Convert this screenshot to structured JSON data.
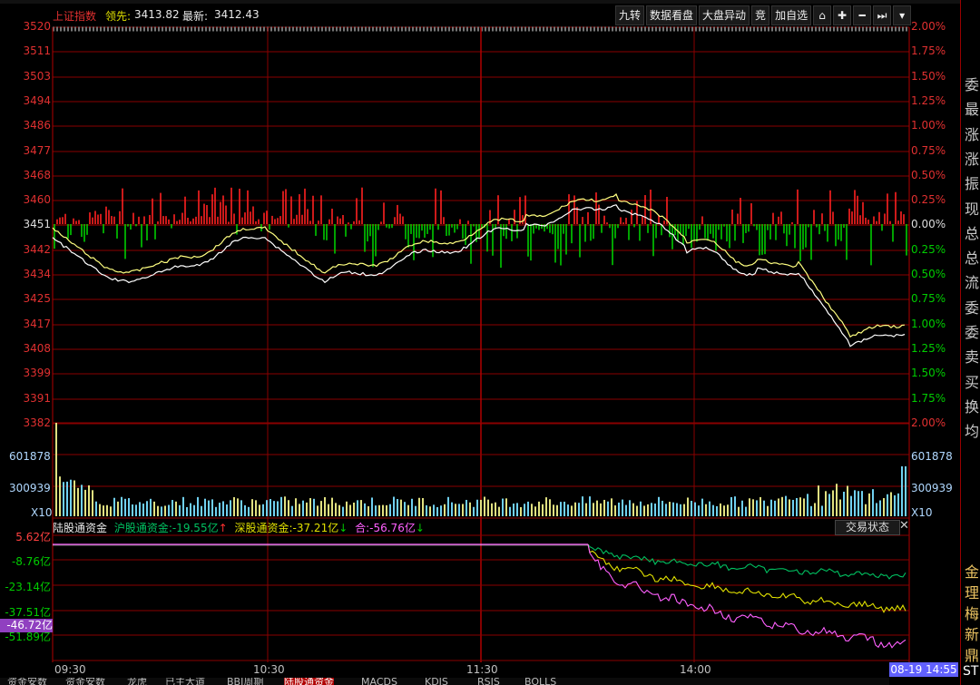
{
  "header": {
    "title": "上证指数",
    "lead_label": "领先:",
    "lead_value": "3413.82",
    "latest_label": "最新:",
    "latest_value": "3412.43"
  },
  "toolbar": {
    "jiuzhuan": "九转",
    "data_board": "数据看盘",
    "market_moves": "大盘异动",
    "jing": "竞",
    "add_watch": "加自选"
  },
  "price_axis": {
    "left": [
      "3520",
      "3511",
      "3503",
      "3494",
      "3486",
      "3477",
      "3468",
      "3460",
      "3451",
      "3442",
      "3434",
      "3425",
      "3417",
      "3408",
      "3399",
      "3391",
      "3382"
    ],
    "right": [
      "2.00%",
      "1.75%",
      "1.50%",
      "1.25%",
      "1.00%",
      "0.75%",
      "0.50%",
      "0.25%",
      "0.00%",
      "0.25%",
      "0.50%",
      "0.75%",
      "1.00%",
      "1.25%",
      "1.50%",
      "1.75%",
      "2.00%"
    ]
  },
  "volume_axis": {
    "high": "601878",
    "mid": "300939",
    "unit": "X10"
  },
  "hgt_panel": {
    "title": "陆股通资金",
    "sh_label": "沪股通资金:",
    "sh_value": "-19.55亿",
    "sh_arrow": "↑",
    "sz_label": "深股通资金:",
    "sz_value": "-37.21亿",
    "sz_arrow": "↓",
    "sum_label": "合:",
    "sum_value": "-56.76亿",
    "sum_arrow": "↓",
    "trade_state": "交易状态",
    "close": "✕",
    "axis": [
      "5.62亿",
      "-8.76亿",
      "-23.14亿",
      "-37.51亿",
      "-51.89亿"
    ],
    "current": "-46.72亿"
  },
  "time_axis": [
    "09:30",
    "10:30",
    "11:30",
    "14:00"
  ],
  "time_badge": "08-19 14:55",
  "sidebar": [
    "委",
    "最",
    "涨",
    "涨",
    "振",
    "现",
    "总",
    "总",
    "流",
    "委",
    "委",
    "卖",
    "买",
    "换",
    "均"
  ],
  "sidebar_lower": [
    "金",
    "理",
    "梅",
    "新",
    "鼎",
    "ST"
  ],
  "bottom_tabs": [
    "资金安数",
    "资金安数",
    "龙虎",
    "已主大道",
    "BBI周期",
    "陆股通资金",
    "MACDS",
    "KDJS",
    "RSIS",
    "BOLLS"
  ],
  "chart_data": {
    "type": "line",
    "series": [],
    "ylim": [
      3382,
      3520
    ]
  },
  "colors": {
    "up": "#ff2020",
    "down": "#00cc00",
    "grid": "#8a0000",
    "price_white": "#ffffff",
    "price_yellow": "#ffff80",
    "sh_green": "#00c060",
    "sz_yellow": "#e0e000",
    "sum_magenta": "#ff60ff"
  }
}
